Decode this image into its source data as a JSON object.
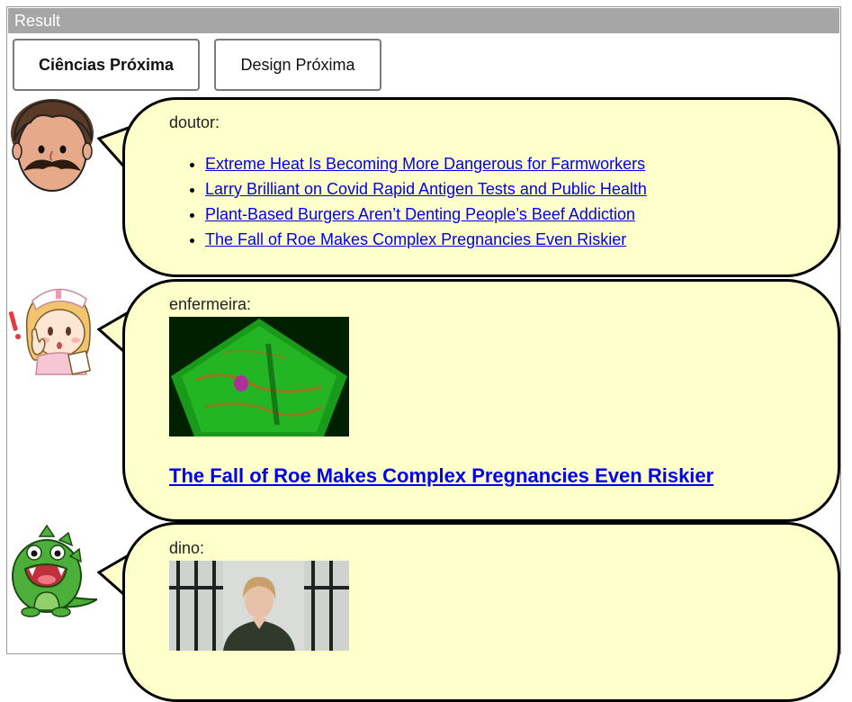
{
  "panel": {
    "title": "Result"
  },
  "buttons": [
    {
      "label": "Ciências Próxima"
    },
    {
      "label": "Design Próxima"
    }
  ],
  "messages": [
    {
      "speaker": "doutor:",
      "avatar_icon": "doctor-icon",
      "links": [
        "Extreme Heat Is Becoming More Dangerous for Farmworkers",
        "Larry Brilliant on Covid Rapid Antigen Tests and Public Health",
        "Plant-Based Burgers Aren’t Denting People’s Beef Addiction",
        "The Fall of Roe Makes Complex Pregnancies Even Riskier"
      ]
    },
    {
      "speaker": "enfermeira:",
      "avatar_icon": "nurse-icon",
      "image": "ultrasound-image",
      "headline": "The Fall of Roe Makes Complex Pregnancies Even Riskier"
    },
    {
      "speaker": "dino:",
      "avatar_icon": "dinosaur-icon",
      "image": "portrait-photo"
    }
  ],
  "colors": {
    "bubble": "#ffffcc",
    "link": "#0000ee",
    "header": "#a6a6a6"
  }
}
